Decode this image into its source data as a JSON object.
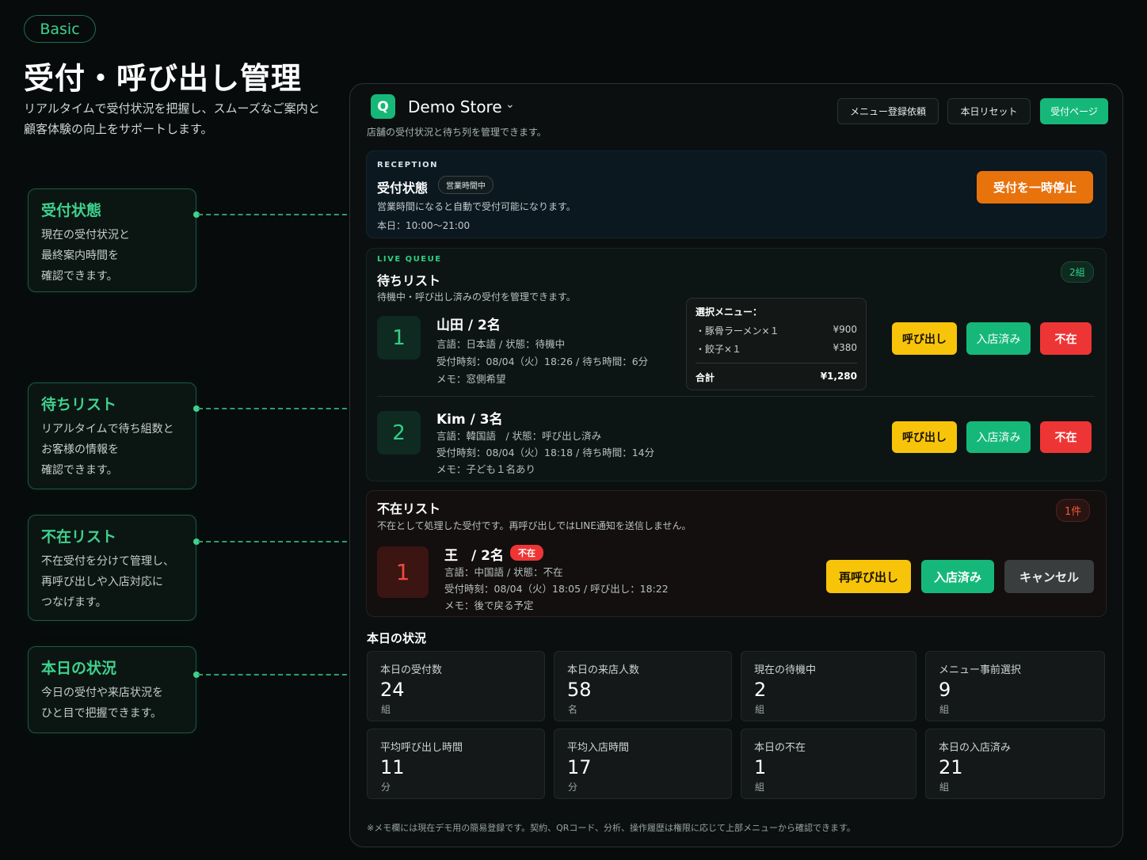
{
  "intro": {
    "badge": "Basic",
    "title": "受付・呼び出し管理",
    "desc_line1": "リアルタイムで受付状況を把握し、スムーズなご案内と",
    "desc_line2": "顧客体験の向上をサポートします。"
  },
  "callouts": [
    {
      "title": "受付状態",
      "lines": [
        "現在の受付状況と",
        "最終案内時間を",
        "確認できます。"
      ]
    },
    {
      "title": "待ちリスト",
      "lines": [
        "リアルタイムで待ち組数と",
        "お客様の情報を",
        "確認できます。"
      ]
    },
    {
      "title": "不在リスト",
      "lines": [
        "不在受付を分けて管理し、",
        "再呼び出しや入店対応に",
        "つなげます。"
      ]
    },
    {
      "title": "本日の状況",
      "lines": [
        "今日の受付や来店状況を",
        "ひと目で把握できます。"
      ]
    }
  ],
  "header": {
    "logo": "Q",
    "store_name": "Demo Store",
    "store_sub": "店舗の受付状況と待ち列を管理できます。",
    "btn_menu_request": "メニュー登録依頼",
    "btn_reset": "本日リセット",
    "btn_reception_page": "受付ページ"
  },
  "reception": {
    "eyebrow": "RECEPTION",
    "title": "受付状態",
    "status_pill": "営業時間中",
    "note": "営業時間になると自動で受付可能になります。",
    "hours": "本日：10:00〜21:00",
    "pause_button": "受付を一時停止"
  },
  "queue": {
    "eyebrow": "LIVE QUEUE",
    "title": "待ちリスト",
    "desc": "待機中・呼び出し済みの受付を管理できます。",
    "count": "2組",
    "items": [
      {
        "number": "1",
        "name": "山田 / 2名",
        "line1": "言語：日本語 / 状態：待機中",
        "line2": "受付時刻：08/04（火）18:26 / 待ち時間：6分",
        "line3": "メモ：窓側希望",
        "btn_call": "呼び出し",
        "btn_seated": "入店済み",
        "btn_absent": "不在"
      },
      {
        "number": "2",
        "name": "Kim / 3名",
        "line1": "言語：韓国語　/ 状態：呼び出し済み",
        "line2": "受付時刻：08/04（火）18:18 / 待ち時間：14分",
        "line3": "メモ：子ども１名あり",
        "btn_call": "呼び出し",
        "btn_seated": "入店済み",
        "btn_absent": "不在"
      }
    ],
    "menu_card": {
      "title": "選択メニュー：",
      "items": [
        {
          "name": "・豚骨ラーメン×１",
          "price": "¥900"
        },
        {
          "name": "・餃子×１",
          "price": "¥380"
        }
      ],
      "total_label": "合計",
      "total_value": "¥1,280"
    }
  },
  "absent": {
    "title": "不在リスト",
    "desc": "不在として処理した受付です。再呼び出しではLINE通知を送信しません。",
    "count": "1件",
    "item": {
      "number": "1",
      "name": "王　/ 2名",
      "tag": "不在",
      "line1": "言語：中国語 / 状態：不在",
      "line2": "受付時刻：08/04（火）18:05 / 呼び出し：18:22",
      "line3": "メモ：後で戻る予定",
      "btn_recall": "再呼び出し",
      "btn_seated": "入店済み",
      "btn_cancel": "キャンセル"
    }
  },
  "today": {
    "title": "本日の状況",
    "stats": [
      {
        "label": "本日の受付数",
        "value": "24",
        "unit": "組"
      },
      {
        "label": "本日の来店人数",
        "value": "58",
        "unit": "名"
      },
      {
        "label": "現在の待機中",
        "value": "2",
        "unit": "組"
      },
      {
        "label": "メニュー事前選択",
        "value": "9",
        "unit": "組"
      },
      {
        "label": "平均呼び出し時間",
        "value": "11",
        "unit": "分"
      },
      {
        "label": "平均入店時間",
        "value": "17",
        "unit": "分"
      },
      {
        "label": "本日の不在",
        "value": "1",
        "unit": "組"
      },
      {
        "label": "本日の入店済み",
        "value": "21",
        "unit": "組"
      }
    ]
  },
  "footnote": "※メモ欄には現在デモ用の簡易登録です。契約、QRコード、分析、操作履歴は権限に応じて上部メニューから確認できます。",
  "colors": {
    "accent": "#16b87a",
    "call": "#f8c40a",
    "absent": "#ee3535",
    "pause": "#e8720c"
  }
}
